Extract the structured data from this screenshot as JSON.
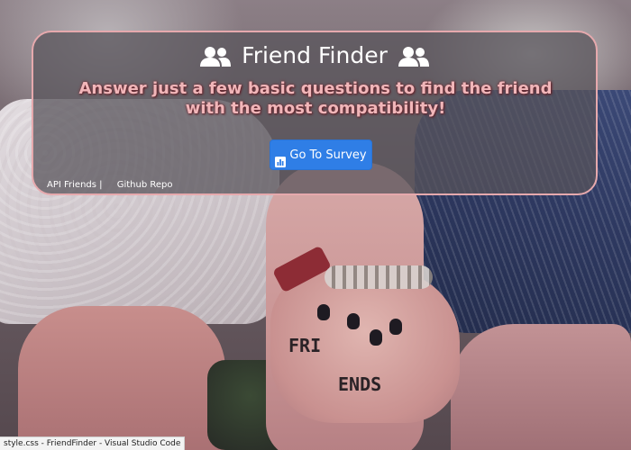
{
  "header": {
    "title": "Friend Finder",
    "left_icon": "users-icon",
    "right_icon": "users-icon",
    "subtitle": "Answer just a few basic questions to find the friend with the most compatibility!"
  },
  "actions": {
    "survey_button_label": "Go To Survey",
    "survey_button_icon": "chart-icon",
    "survey_button_color": "#2f7ee6"
  },
  "footer_links": {
    "api_friends": "API Friends",
    "separator": "|",
    "github_repo": "Github Repo"
  },
  "status_bar": {
    "text": "style.css - FriendFinder - Visual Studio Code"
  },
  "background": {
    "tattoo_letters_left": "FRI",
    "tattoo_letters_right": "ENDS"
  },
  "colors": {
    "panel_border": "#e6a9ad",
    "subtitle_text": "#f1b6b9"
  }
}
